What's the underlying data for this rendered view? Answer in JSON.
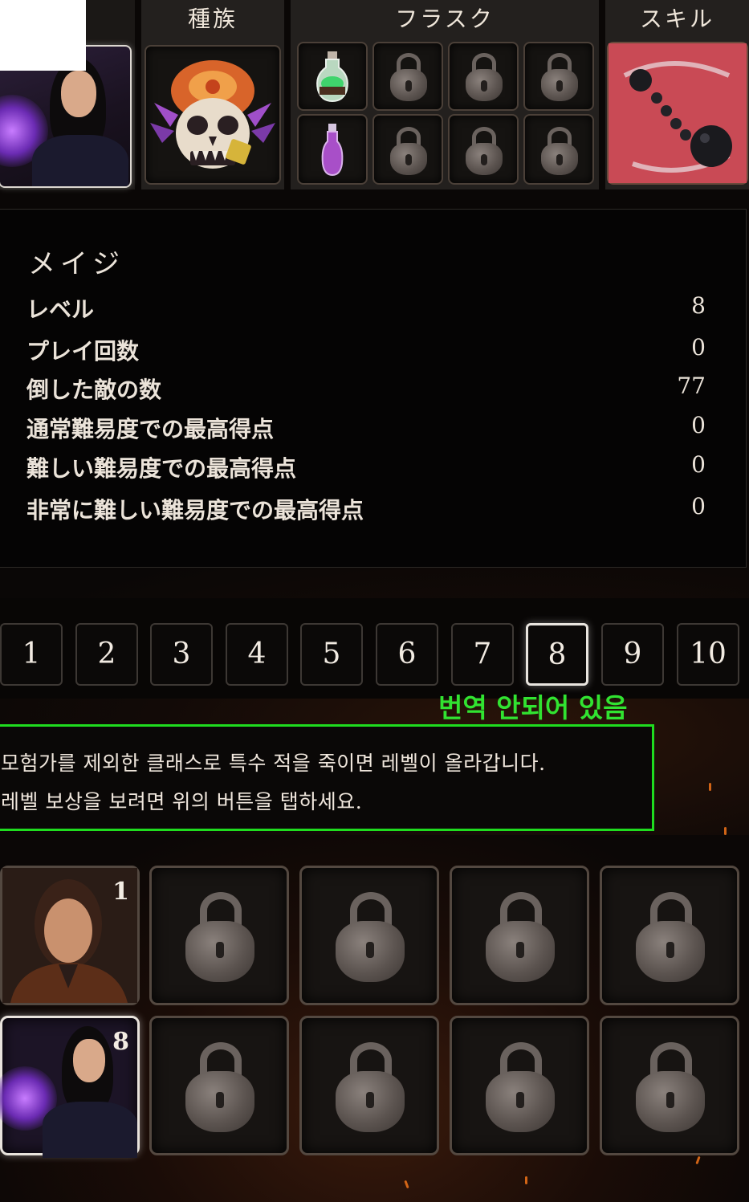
{
  "tabs": {
    "race": "種族",
    "flask": "フラスク",
    "skill": "スキル"
  },
  "stats": {
    "class_name": "メイジ",
    "rows": [
      {
        "label": "レベル",
        "value": "8"
      },
      {
        "label": "プレイ回数",
        "value": "0"
      },
      {
        "label": "倒した敵の数",
        "value": "77"
      },
      {
        "label": "通常難易度での最高得点",
        "value": "0"
      },
      {
        "label": "難しい難易度での最高得点",
        "value": "0"
      },
      {
        "label": "非常に難しい難易度での最高得点",
        "value": "0"
      }
    ]
  },
  "levels": {
    "buttons": [
      "1",
      "2",
      "3",
      "4",
      "5",
      "6",
      "7",
      "8",
      "9",
      "10"
    ],
    "selected": "8"
  },
  "note": "번역 안되어 있음",
  "description": {
    "line1": "모험가를 제외한 클래스로 특수 적을 죽이면 레벨이 올라갑니다.",
    "line2": "레벨 보상을 보려면 위의 버튼을 탭하세요."
  },
  "characters": {
    "adventurer_level": "1",
    "mage_level": "8"
  },
  "icons": {
    "race": "skull-mask-icon",
    "skill": "chain-ball-icon",
    "locked": "padlock-icon",
    "flask_green": "green-potion-icon",
    "flask_purple": "purple-potion-icon"
  }
}
